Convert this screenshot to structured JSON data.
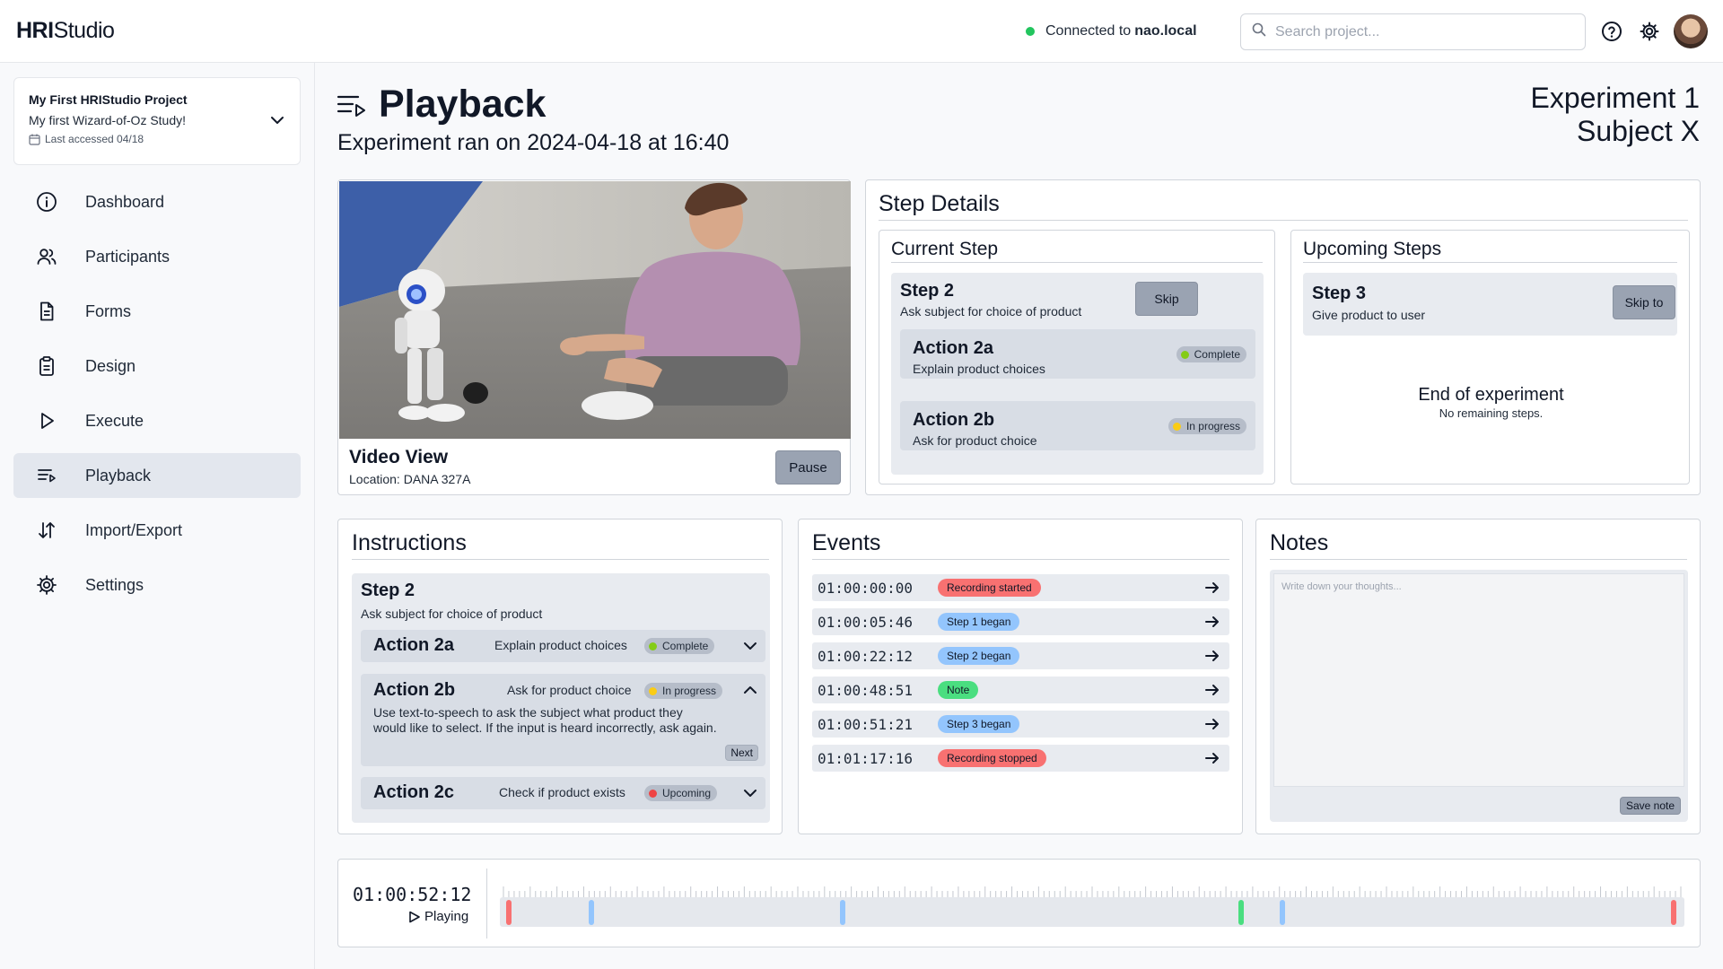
{
  "topbar": {
    "logo_bold": "HRI",
    "logo_rest": "Studio",
    "connected_prefix": "Connected to",
    "connected_host": "nao.local",
    "search_placeholder": "Search project..."
  },
  "sidebar": {
    "project_name": "My First HRIStudio Project",
    "study_name": "My first Wizard-of-Oz Study!",
    "last_accessed": "Last accessed 04/18",
    "items": [
      {
        "label": "Dashboard",
        "icon": "info-icon"
      },
      {
        "label": "Participants",
        "icon": "users-icon"
      },
      {
        "label": "Forms",
        "icon": "document-icon"
      },
      {
        "label": "Design",
        "icon": "clipboard-icon"
      },
      {
        "label": "Execute",
        "icon": "play-icon"
      },
      {
        "label": "Playback",
        "icon": "playlist-icon",
        "active": true
      },
      {
        "label": "Import/Export",
        "icon": "arrows-updown-icon"
      },
      {
        "label": "Settings",
        "icon": "gear-icon"
      }
    ]
  },
  "page": {
    "title": "Playback",
    "subtitle": "Experiment ran on 2024-04-18 at 16:40",
    "experiment": "Experiment 1",
    "subject": "Subject X"
  },
  "video": {
    "title": "Video View",
    "location_label": "Location:",
    "location": "DANA 327A",
    "pause_label": "Pause"
  },
  "step_details": {
    "title": "Step Details",
    "current": {
      "title": "Current Step",
      "step_title": "Step 2",
      "step_desc": "Ask subject for choice of product",
      "skip_label": "Skip",
      "actions": [
        {
          "title": "Action 2a",
          "desc": "Explain product choices",
          "status": "Complete",
          "color": "#84cc16"
        },
        {
          "title": "Action 2b",
          "desc": "Ask for product choice",
          "status": "In progress",
          "color": "#facc15"
        }
      ]
    },
    "upcoming": {
      "title": "Upcoming Steps",
      "step_title": "Step 3",
      "step_desc": "Give product to user",
      "skip_label": "Skip to",
      "end_title": "End of experiment",
      "end_sub": "No remaining steps."
    }
  },
  "instructions": {
    "title": "Instructions",
    "step_title": "Step 2",
    "step_desc": "Ask subject for choice of product",
    "actions": [
      {
        "title": "Action 2a",
        "desc": "Explain product choices",
        "status": "Complete",
        "color": "#84cc16"
      },
      {
        "title": "Action 2b",
        "desc": "Ask for product choice",
        "status": "In progress",
        "color": "#facc15",
        "detail_1": "Use text-to-speech to ask the subject what product they",
        "detail_2": "would like to select. If the input is heard incorrectly, ask again.",
        "next_label": "Next"
      },
      {
        "title": "Action 2c",
        "desc": "Check if product exists",
        "status": "Upcoming",
        "color": "#ef4444"
      }
    ]
  },
  "events": {
    "title": "Events",
    "rows": [
      {
        "time": "01:00:00:00",
        "label": "Recording started",
        "color": "#f87171"
      },
      {
        "time": "01:00:05:46",
        "label": "Step 1 began",
        "color": "#93c5fd"
      },
      {
        "time": "01:00:22:12",
        "label": "Step 2 began",
        "color": "#93c5fd"
      },
      {
        "time": "01:00:48:51",
        "label": "Note",
        "color": "#4ade80"
      },
      {
        "time": "01:00:51:21",
        "label": "Step 3 began",
        "color": "#93c5fd"
      },
      {
        "time": "01:01:17:16",
        "label": "Recording stopped",
        "color": "#f87171"
      }
    ]
  },
  "notes": {
    "title": "Notes",
    "placeholder": "Write down your thoughts...",
    "save_label": "Save note"
  },
  "timeline": {
    "current_time": "01:00:52:12",
    "status": "Playing",
    "duration_seconds": 77.27,
    "markers": [
      {
        "t": 0.0,
        "color": "#f87171"
      },
      {
        "t": 5.46,
        "color": "#93c5fd"
      },
      {
        "t": 22.12,
        "color": "#93c5fd"
      },
      {
        "t": 48.51,
        "color": "#4ade80"
      },
      {
        "t": 51.21,
        "color": "#93c5fd"
      },
      {
        "t": 77.16,
        "color": "#f87171"
      }
    ]
  }
}
